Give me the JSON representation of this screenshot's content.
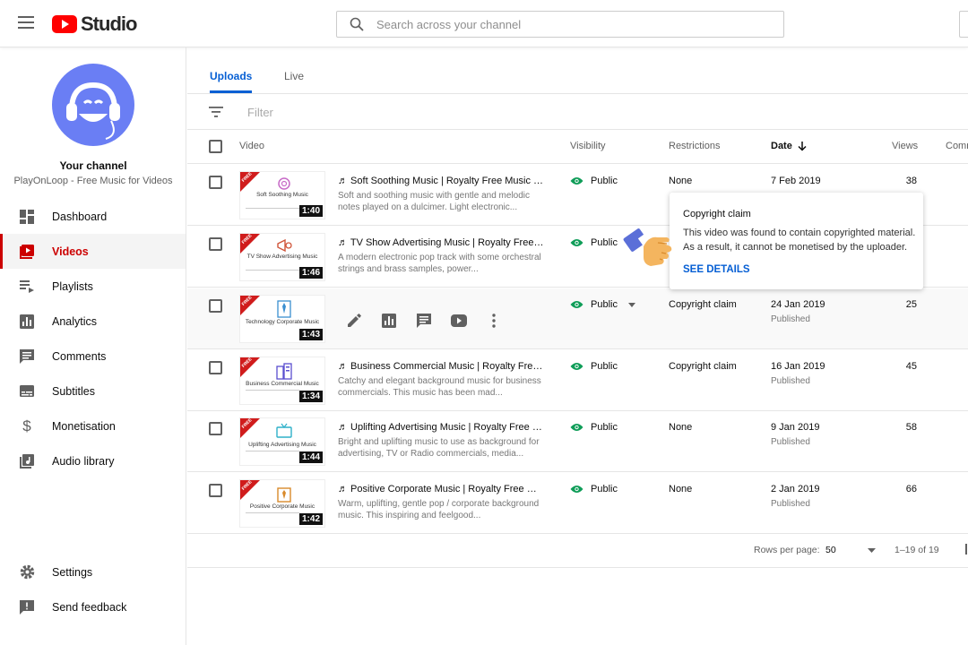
{
  "app": {
    "logo_text": "Studio"
  },
  "search": {
    "placeholder": "Search across your channel"
  },
  "sidebar": {
    "channel_name": "Your channel",
    "channel_subtitle": "PlayOnLoop - Free Music for Videos",
    "items": [
      {
        "label": "Dashboard",
        "icon": "dashboard-icon"
      },
      {
        "label": "Videos",
        "icon": "videos-icon",
        "active": true
      },
      {
        "label": "Playlists",
        "icon": "playlists-icon"
      },
      {
        "label": "Analytics",
        "icon": "analytics-icon"
      },
      {
        "label": "Comments",
        "icon": "comments-icon"
      },
      {
        "label": "Subtitles",
        "icon": "subtitles-icon"
      },
      {
        "label": "Monetisation",
        "icon": "dollar-icon"
      },
      {
        "label": "Audio library",
        "icon": "audio-library-icon"
      }
    ],
    "bottom_items": [
      {
        "label": "Settings",
        "icon": "gear-icon"
      },
      {
        "label": "Send feedback",
        "icon": "feedback-icon"
      }
    ]
  },
  "tabs": [
    {
      "label": "Uploads",
      "active": true
    },
    {
      "label": "Live"
    }
  ],
  "filter": {
    "placeholder": "Filter"
  },
  "table": {
    "headers": {
      "video": "Video",
      "visibility": "Visibility",
      "restrictions": "Restrictions",
      "date": "Date",
      "views": "Views",
      "comments": "Comm"
    },
    "rows": [
      {
        "thumb_title": "Soft Soothing Music",
        "duration": "1:40",
        "title": "♬ Soft Soothing Music | Royalty Free Music [wi...",
        "desc": "Soft and soothing music with gentle and melodic notes played on a dulcimer. Light electronic...",
        "visibility": "Public",
        "restriction": "None",
        "date": "7 Feb 2019",
        "status": "",
        "views": "38"
      },
      {
        "thumb_title": "TV Show Advertising Music",
        "duration": "1:46",
        "title": "♬ TV Show Advertising Music | Royalty Free M...",
        "desc": "A modern electronic pop track with some orchestral strings and brass samples, power...",
        "visibility": "Public",
        "restriction": "",
        "date": "",
        "status": "",
        "views": ""
      },
      {
        "thumb_title": "Technology Corporate Music",
        "duration": "1:43",
        "title": "",
        "desc": "",
        "visibility": "Public",
        "restriction": "Copyright claim",
        "date": "24 Jan 2019",
        "status": "Published",
        "views": "25"
      },
      {
        "thumb_title": "Business Commercial Music",
        "duration": "1:34",
        "title": "♬ Business Commercial Music | Royalty Free ...",
        "desc": "Catchy and elegant background music for business commercials. This music has been mad...",
        "visibility": "Public",
        "restriction": "Copyright claim",
        "date": "16 Jan 2019",
        "status": "Published",
        "views": "45"
      },
      {
        "thumb_title": "Uplifting Advertising Music",
        "duration": "1:44",
        "title": "♬ Uplifting Advertising Music | Royalty Free M...",
        "desc": "Bright and uplifting music to use as background for advertising, TV or Radio commercials, media...",
        "visibility": "Public",
        "restriction": "None",
        "date": "9 Jan 2019",
        "status": "Published",
        "views": "58"
      },
      {
        "thumb_title": "Positive Corporate Music",
        "duration": "1:42",
        "title": "♬ Positive Corporate Music | Royalty Free Mus...",
        "desc": "Warm, uplifting, gentle pop / corporate background music. This inspiring and feelgood...",
        "visibility": "Public",
        "restriction": "None",
        "date": "2 Jan 2019",
        "status": "Published",
        "views": "66"
      }
    ]
  },
  "badge_text": "FREE",
  "pager": {
    "rows_label": "Rows per page:",
    "rows_value": "50",
    "range": "1–19 of 19"
  },
  "tooltip": {
    "title": "Copyright claim",
    "text": "This video was found to contain copyrighted material. As a result, it cannot be monetised by the uploader.",
    "link": "SEE DETAILS"
  },
  "colors": {
    "accent": "#065fd4",
    "brand": "#ff0000",
    "active_nav": "#cc0000",
    "public_eye": "#0f9d58",
    "free_badge": "#d01c1c"
  }
}
